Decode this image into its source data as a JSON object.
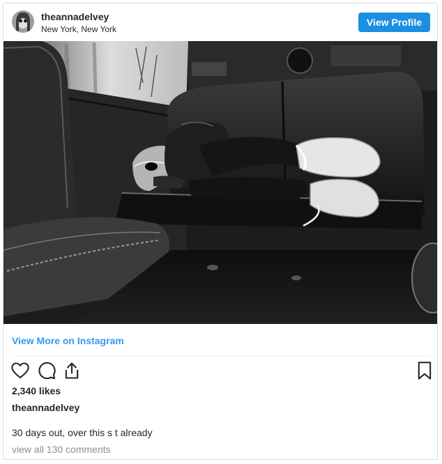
{
  "post": {
    "username": "theannadelvey",
    "location": "New York, New York",
    "view_profile_label": "View Profile",
    "view_more_label": "View More on Instagram",
    "likes": "2,340 likes",
    "owner": "theannadelvey",
    "caption": "30 days out, over this s t already",
    "comments_link": "view all 130 comments"
  },
  "colors": {
    "accent": "#1a8fe3",
    "link": "#3897f0",
    "text": "#262626",
    "muted": "#8e8e8e"
  },
  "icons": [
    "heart-icon",
    "comment-icon",
    "share-icon",
    "bookmark-icon"
  ]
}
